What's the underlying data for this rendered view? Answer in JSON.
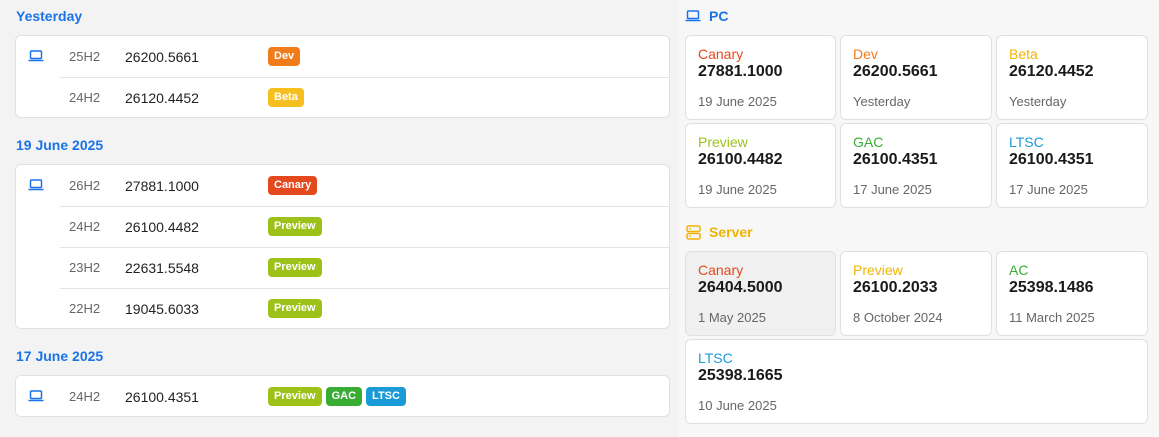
{
  "groups": [
    {
      "date": "Yesterday",
      "rows": [
        {
          "version": "25H2",
          "build": "26200.5661",
          "badges": [
            {
              "label": "Dev",
              "color": "#f07c1a"
            }
          ]
        },
        {
          "version": "24H2",
          "build": "26120.4452",
          "badges": [
            {
              "label": "Beta",
              "color": "#f5bf1f"
            }
          ]
        }
      ]
    },
    {
      "date": "19 June 2025",
      "rows": [
        {
          "version": "26H2",
          "build": "27881.1000",
          "badges": [
            {
              "label": "Canary",
              "color": "#e4491e"
            }
          ]
        },
        {
          "version": "24H2",
          "build": "26100.4482",
          "badges": [
            {
              "label": "Preview",
              "color": "#9cc21a"
            }
          ]
        },
        {
          "version": "23H2",
          "build": "22631.5548",
          "badges": [
            {
              "label": "Preview",
              "color": "#9cc21a"
            }
          ]
        },
        {
          "version": "22H2",
          "build": "19045.6033",
          "badges": [
            {
              "label": "Preview",
              "color": "#9cc21a"
            }
          ]
        }
      ]
    },
    {
      "date": "17 June 2025",
      "rows": [
        {
          "version": "24H2",
          "build": "26100.4351",
          "badges": [
            {
              "label": "Preview",
              "color": "#9cc21a"
            },
            {
              "label": "GAC",
              "color": "#3aac34"
            },
            {
              "label": "LTSC",
              "color": "#1a9ad6"
            }
          ]
        }
      ]
    }
  ],
  "pc": {
    "title": "PC",
    "title_color": "#1a73e8",
    "cards": [
      {
        "channel": "Canary",
        "color": "#e4491e",
        "build": "27881.1000",
        "date": "19 June 2025"
      },
      {
        "channel": "Dev",
        "color": "#f07c1a",
        "build": "26200.5661",
        "date": "Yesterday"
      },
      {
        "channel": "Beta",
        "color": "#f0b400",
        "build": "26120.4452",
        "date": "Yesterday"
      },
      {
        "channel": "Preview",
        "color": "#9cc21a",
        "build": "26100.4482",
        "date": "19 June 2025"
      },
      {
        "channel": "GAC",
        "color": "#3aac34",
        "build": "26100.4351",
        "date": "17 June 2025"
      },
      {
        "channel": "LTSC",
        "color": "#1a9ad6",
        "build": "26100.4351",
        "date": "17 June 2025"
      }
    ]
  },
  "server": {
    "title": "Server",
    "title_color": "#f0b400",
    "cards": [
      {
        "channel": "Canary",
        "color": "#e4491e",
        "build": "26404.5000",
        "date": "1 May 2025"
      },
      {
        "channel": "Preview",
        "color": "#f0b400",
        "build": "26100.2033",
        "date": "8 October 2024"
      },
      {
        "channel": "AC",
        "color": "#3aac34",
        "build": "25398.1486",
        "date": "11 March 2025"
      },
      {
        "channel": "LTSC",
        "color": "#1a9ad6",
        "build": "25398.1665",
        "date": "10 June 2025"
      }
    ]
  },
  "icons": {
    "device": "laptop-icon",
    "pc": "laptop-icon",
    "server": "server-icon"
  }
}
